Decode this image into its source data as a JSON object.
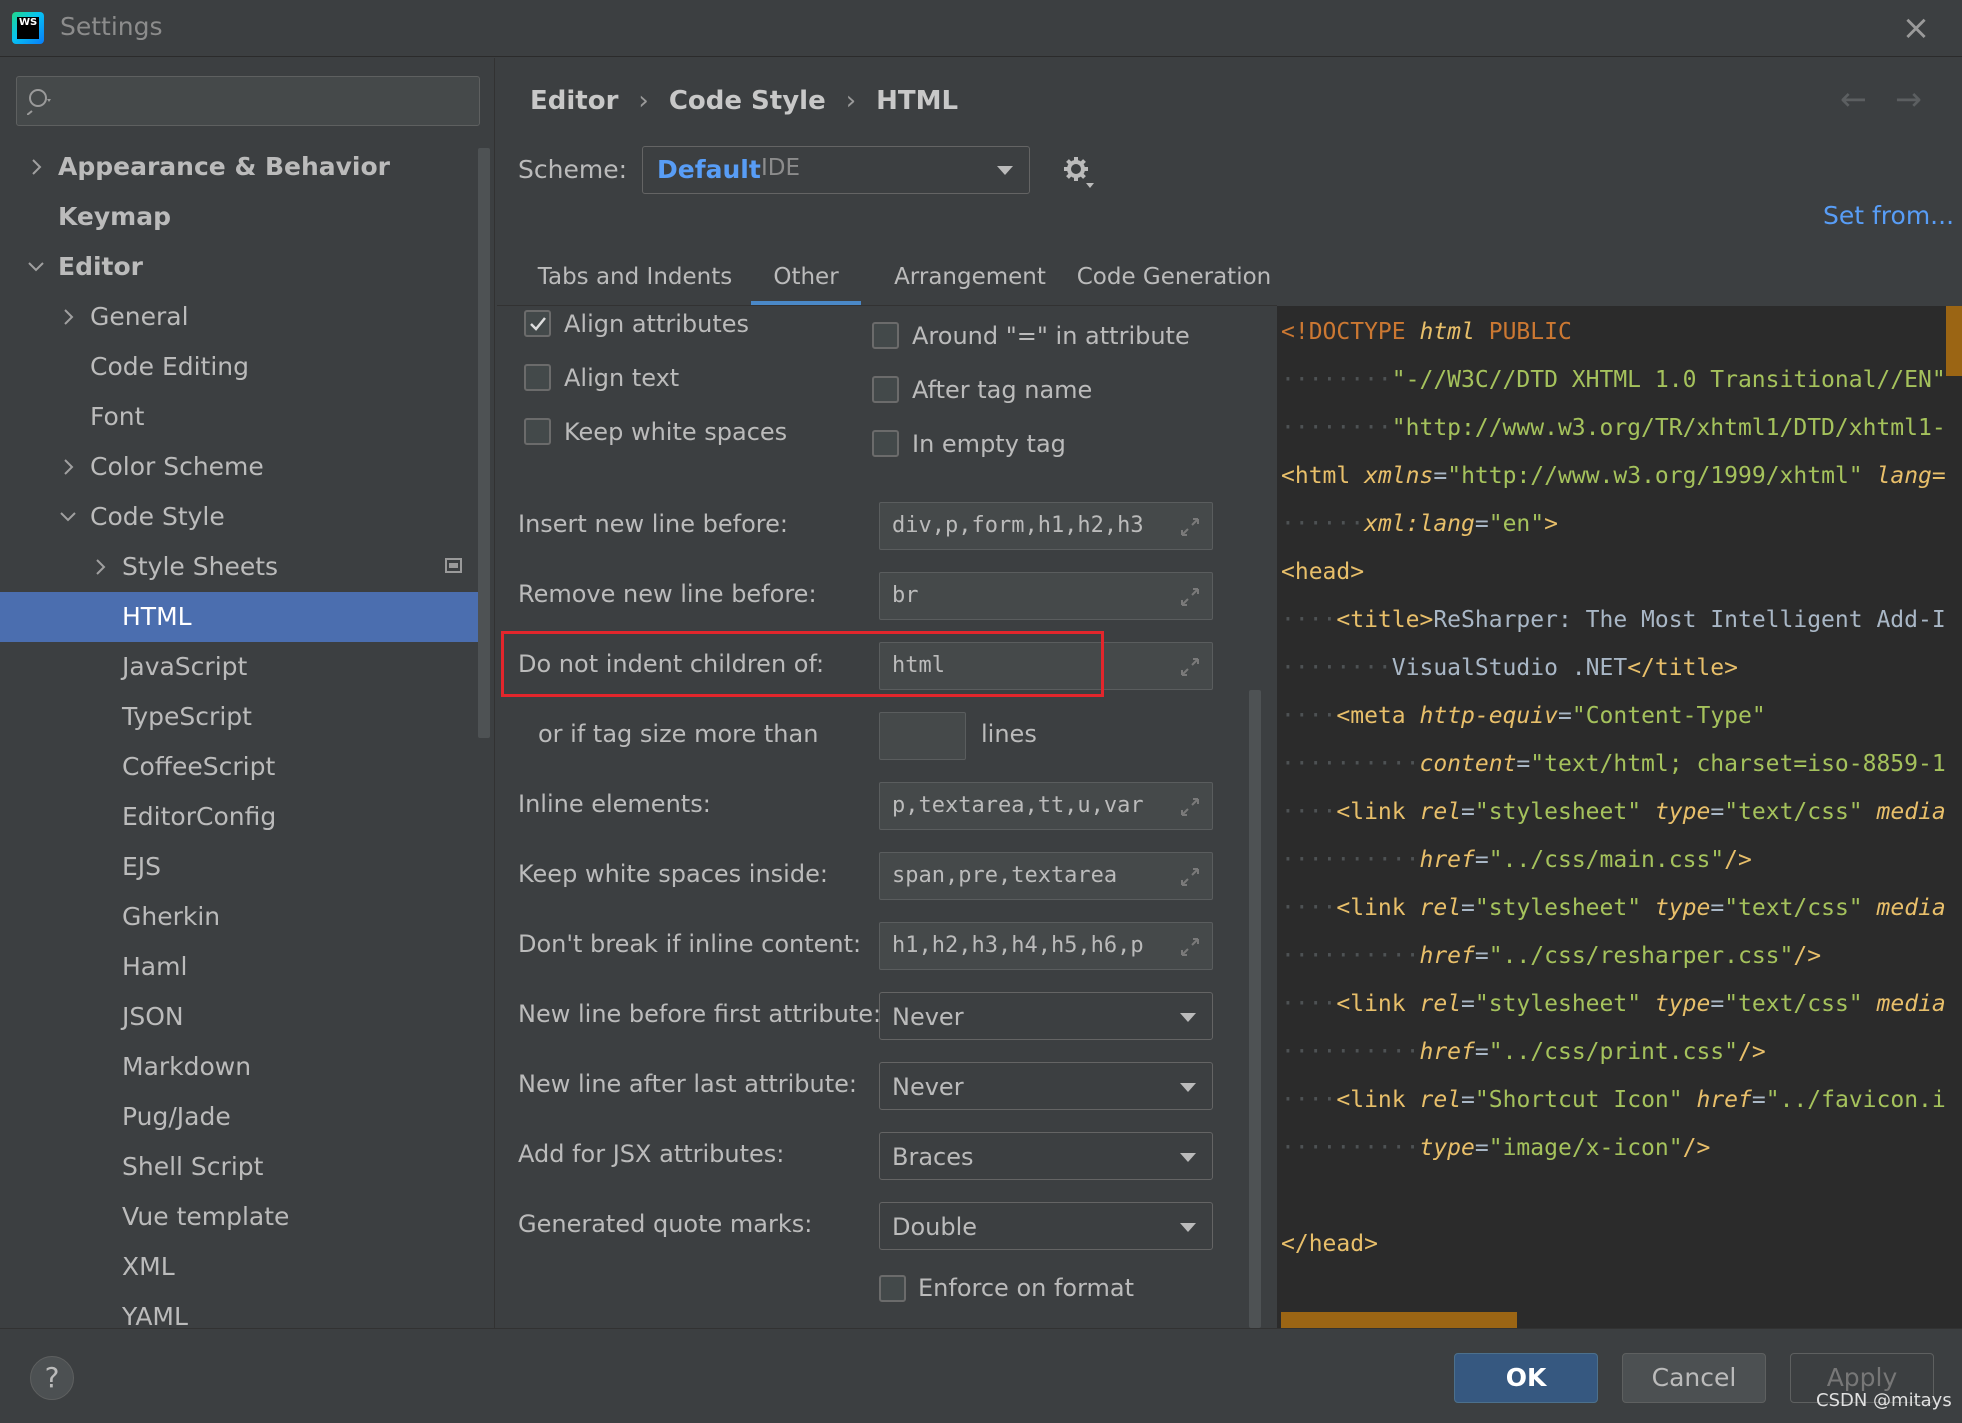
{
  "window": {
    "title": "Settings",
    "app_icon_text": "WS"
  },
  "search": {
    "placeholder": ""
  },
  "tree": [
    {
      "label": "Appearance & Behavior",
      "level": 0,
      "bold": true,
      "chevron": "right"
    },
    {
      "label": "Keymap",
      "level": 0,
      "bold": true,
      "chevron": ""
    },
    {
      "label": "Editor",
      "level": 0,
      "bold": true,
      "chevron": "down"
    },
    {
      "label": "General",
      "level": 1,
      "chevron": "right"
    },
    {
      "label": "Code Editing",
      "level": 1,
      "chevron": ""
    },
    {
      "label": "Font",
      "level": 1,
      "chevron": ""
    },
    {
      "label": "Color Scheme",
      "level": 1,
      "chevron": "right"
    },
    {
      "label": "Code Style",
      "level": 1,
      "chevron": "down"
    },
    {
      "label": "Style Sheets",
      "level": 2,
      "chevron": "right"
    },
    {
      "label": "HTML",
      "level": 2,
      "chevron": "",
      "selected": true
    },
    {
      "label": "JavaScript",
      "level": 2,
      "chevron": ""
    },
    {
      "label": "TypeScript",
      "level": 2,
      "chevron": ""
    },
    {
      "label": "CoffeeScript",
      "level": 2,
      "chevron": ""
    },
    {
      "label": "EditorConfig",
      "level": 2,
      "chevron": ""
    },
    {
      "label": "EJS",
      "level": 2,
      "chevron": ""
    },
    {
      "label": "Gherkin",
      "level": 2,
      "chevron": ""
    },
    {
      "label": "Haml",
      "level": 2,
      "chevron": ""
    },
    {
      "label": "JSON",
      "level": 2,
      "chevron": ""
    },
    {
      "label": "Markdown",
      "level": 2,
      "chevron": ""
    },
    {
      "label": "Pug/Jade",
      "level": 2,
      "chevron": ""
    },
    {
      "label": "Shell Script",
      "level": 2,
      "chevron": ""
    },
    {
      "label": "Vue template",
      "level": 2,
      "chevron": ""
    },
    {
      "label": "XML",
      "level": 2,
      "chevron": ""
    },
    {
      "label": "YAML",
      "level": 2,
      "chevron": ""
    }
  ],
  "breadcrumb": [
    "Editor",
    "Code Style",
    "HTML"
  ],
  "nav": {
    "back": "←",
    "forward": "→"
  },
  "scheme": {
    "label": "Scheme:",
    "name": "Default",
    "kind": "IDE"
  },
  "set_from": "Set from...",
  "tabs": [
    {
      "label": "Tabs and Indents",
      "active": false
    },
    {
      "label": "Other",
      "active": true
    },
    {
      "label": "Arrangement",
      "active": false
    },
    {
      "label": "Code Generation",
      "active": false
    }
  ],
  "checkboxes_left": [
    {
      "label": "Align attributes",
      "checked": true
    },
    {
      "label": "Align text",
      "checked": false
    },
    {
      "label": "Keep white spaces",
      "checked": false
    }
  ],
  "checkboxes_right": [
    {
      "label": "Around \"=\" in attribute",
      "checked": false
    },
    {
      "label": "After tag name",
      "checked": false
    },
    {
      "label": "In empty tag",
      "checked": false
    }
  ],
  "fields": {
    "insert_new_line_before": {
      "label": "Insert new line before:",
      "value": "div,p,form,h1,h2,h3"
    },
    "remove_new_line_before": {
      "label": "Remove new line before:",
      "value": "br"
    },
    "do_not_indent_children": {
      "label": "Do not indent children of:",
      "value": "html"
    },
    "tag_size": {
      "label": "or if tag size more than",
      "value": "",
      "suffix": "lines"
    },
    "inline_elements": {
      "label": "Inline elements:",
      "value": "p,textarea,tt,u,var"
    },
    "keep_white_spaces_inside": {
      "label": "Keep white spaces inside:",
      "value": "span,pre,textarea"
    },
    "dont_break_inline": {
      "label": "Don't break if inline content:",
      "value": "h1,h2,h3,h4,h5,h6,p"
    }
  },
  "selects": {
    "new_line_before_first_attr": {
      "label": "New line before first attribute:",
      "value": "Never"
    },
    "new_line_after_last_attr": {
      "label": "New line after last attribute:",
      "value": "Never"
    },
    "jsx_attributes": {
      "label": "Add for JSX attributes:",
      "value": "Braces"
    },
    "quote_marks": {
      "label": "Generated quote marks:",
      "value": "Double"
    }
  },
  "enforce_on_format": {
    "label": "Enforce on format",
    "checked": false
  },
  "preview": {
    "l1_kw": "<!DOCTYPE",
    "l1_attr": "html",
    "l1_kw2": "PUBLIC",
    "l2_dots": "········",
    "l2_str": "\"-//W3C//DTD XHTML 1.0 Transitional//EN\"",
    "l3_dots": "········",
    "l3_str": "\"http://www.w3.org/TR/xhtml1/DTD/xhtml1-",
    "l4_tag": "<html",
    "l4_attr": "xmlns",
    "l4_eq": "=",
    "l4_str": "\"http://www.w3.org/1999/xhtml\"",
    "l4_attr2": "lang=",
    "l5_dots": "······",
    "l5_attr": "xml:lang",
    "l5_eq": "=",
    "l5_str": "\"en\"",
    "l5_end": ">",
    "l6_tag": "<head>",
    "l7_dots": "····",
    "l7_tag": "<title>",
    "l7_text": "ReSharper: The Most Intelligent Add-I",
    "l8_dots": "········",
    "l8_text": "VisualStudio .NET",
    "l8_tag": "</title>",
    "l9_dots": "····",
    "l9_tag": "<meta",
    "l9_attr": "http-equiv",
    "l9_eq": "=",
    "l9_str": "\"Content-Type\"",
    "l10_dots": "··········",
    "l10_attr": "content",
    "l10_eq": "=",
    "l10_str": "\"text/html; charset=iso-8859-1",
    "l11_dots": "····",
    "l11_tag": "<link",
    "l11_attr": "rel",
    "l11_str": "\"stylesheet\"",
    "l11_attr2": "type",
    "l11_str2": "\"text/css\"",
    "l11_attr3": "media",
    "l12_dots": "··········",
    "l12_attr": "href",
    "l12_str": "\"../css/main.css\"",
    "l12_end": "/>",
    "l13_dots": "····",
    "l13_tag": "<link",
    "l13_attr": "rel",
    "l13_str": "\"stylesheet\"",
    "l13_attr2": "type",
    "l13_str2": "\"text/css\"",
    "l13_attr3": "media",
    "l14_dots": "··········",
    "l14_attr": "href",
    "l14_str": "\"../css/resharper.css\"",
    "l14_end": "/>",
    "l15_dots": "····",
    "l15_tag": "<link",
    "l15_attr": "rel",
    "l15_str": "\"stylesheet\"",
    "l15_attr2": "type",
    "l15_str2": "\"text/css\"",
    "l15_attr3": "media",
    "l16_dots": "··········",
    "l16_attr": "href",
    "l16_str": "\"../css/print.css\"",
    "l16_end": "/>",
    "l17_dots": "····",
    "l17_tag": "<link",
    "l17_attr": "rel",
    "l17_str": "\"Shortcut Icon\"",
    "l17_attr2": "href",
    "l17_str2": "\"../favicon.i",
    "l18_dots": "··········",
    "l18_attr": "type",
    "l18_str": "\"image/x-icon\"",
    "l18_end": "/>",
    "l19_tag": "</head>"
  },
  "buttons": {
    "help": "?",
    "ok": "OK",
    "cancel": "Cancel",
    "apply": "Apply"
  },
  "watermark": "CSDN @mitays",
  "colors": {
    "background": "#3c3f41",
    "selection": "#4b6eaf",
    "link": "#589df6",
    "editor_bg": "#2b2b2b",
    "highlight": "#e3262c"
  }
}
